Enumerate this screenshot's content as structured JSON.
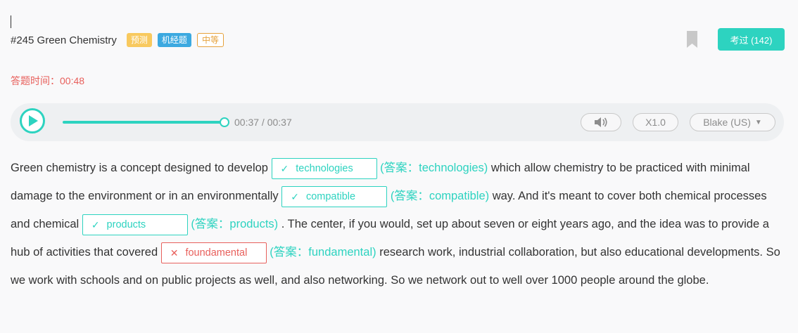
{
  "question": {
    "title": "#245 Green Chemistry",
    "tags": {
      "predict": "预测",
      "machine": "机经题",
      "level": "中等"
    },
    "pass_button": "考过 (142)"
  },
  "timer": {
    "text": "答题时间：00:48"
  },
  "player": {
    "time": "00:37 / 00:37",
    "progress_fraction": 1.0,
    "speed": "X1.0",
    "voice": "Blake (US)",
    "icons": {
      "play": "play-icon",
      "volume": "volume-icon",
      "bookmark": "bookmark-icon",
      "dropdown": "caret-down-icon"
    }
  },
  "passage": {
    "segments": {
      "s1": "Green chemistry is a concept designed to develop ",
      "s2": " which allow chemistry to be practiced with minimal damage to the environment or in an environmentally ",
      "s3": " way. And it's meant to cover both chemical processes and chemical ",
      "s4": " . The center, if you would, set up about seven or eight years ago, and the idea was to provide a hub of activities that covered ",
      "s5": " research work, industrial collaboration, but also educational developments. So we work with schools and on public projects as well, and also networking. So we network out to well over 1000 people around the globe."
    },
    "blanks": [
      {
        "user": "technologies",
        "mark": "✓",
        "status": "correct",
        "answer": "(答案：technologies)"
      },
      {
        "user": "compatible",
        "mark": "✓",
        "status": "correct",
        "answer": "(答案：compatible)"
      },
      {
        "user": "products",
        "mark": "✓",
        "status": "correct",
        "answer": "(答案：products)"
      },
      {
        "user": "foundamental",
        "mark": "✕",
        "status": "wrong",
        "answer": "(答案：fundamental)"
      }
    ]
  },
  "colors": {
    "accent": "#2dd3c0",
    "error": "#e8605c",
    "tag_predict": "#f8c95e",
    "tag_machine": "#3ca9e0",
    "tag_level": "#e6a23c"
  }
}
